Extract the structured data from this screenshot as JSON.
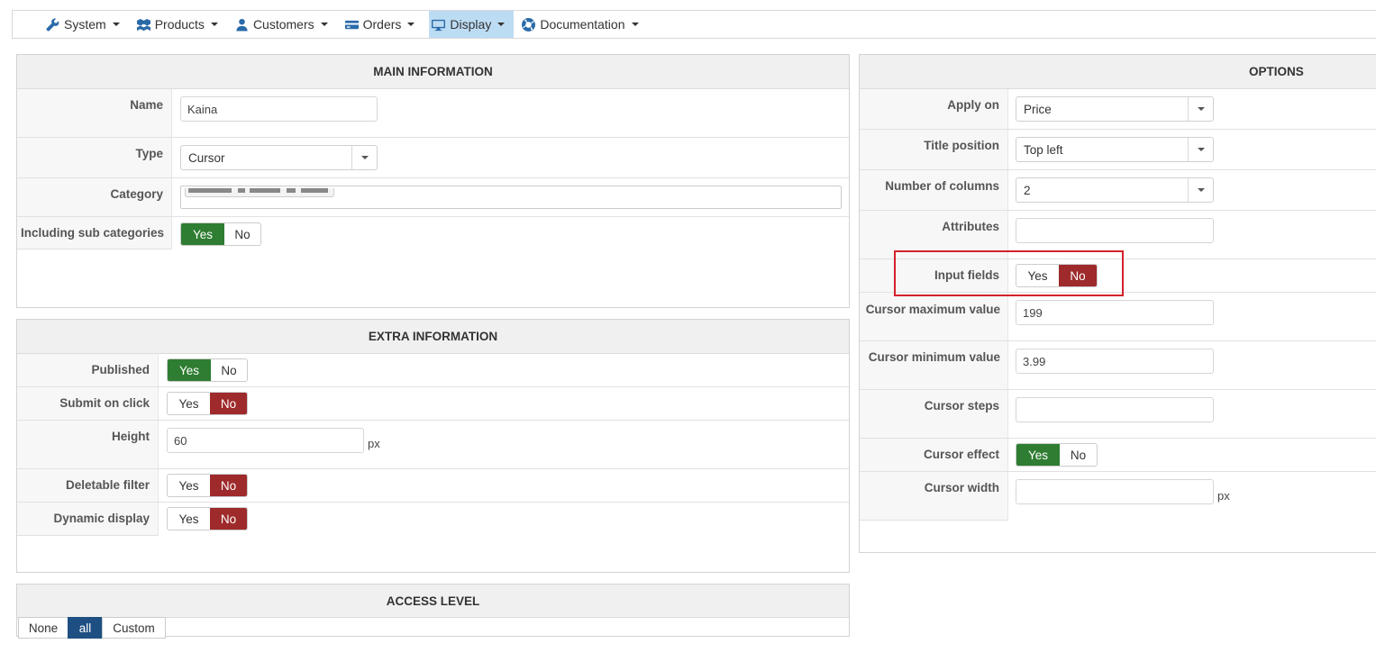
{
  "menu": [
    {
      "label": "System",
      "icon": "wrench-icon"
    },
    {
      "label": "Products",
      "icon": "cubes-icon"
    },
    {
      "label": "Customers",
      "icon": "user-icon"
    },
    {
      "label": "Orders",
      "icon": "credit-card-icon"
    },
    {
      "label": "Display",
      "icon": "monitor-icon",
      "active": true
    },
    {
      "label": "Documentation",
      "icon": "lifebuoy-icon"
    }
  ],
  "main_info": {
    "title": "MAIN INFORMATION",
    "name_label": "Name",
    "name_value": "Kaina",
    "type_label": "Type",
    "type_value": "Cursor",
    "category_label": "Category",
    "sub_label": "Including sub categories",
    "sub_value": "Yes"
  },
  "extra_info": {
    "title": "EXTRA INFORMATION",
    "published_label": "Published",
    "published_value": "Yes",
    "submit_label": "Submit on click",
    "submit_value": "No",
    "height_label": "Height",
    "height_value": "60",
    "height_unit": "px",
    "deletable_label": "Deletable filter",
    "deletable_value": "No",
    "dynamic_label": "Dynamic display",
    "dynamic_value": "No"
  },
  "access": {
    "title": "ACCESS LEVEL",
    "none": "None",
    "all": "all",
    "custom": "Custom",
    "selected": "all"
  },
  "options": {
    "title": "OPTIONS",
    "apply_label": "Apply on",
    "apply_value": "Price",
    "title_pos_label": "Title position",
    "title_pos_value": "Top left",
    "cols_label": "Number of columns",
    "cols_value": "2",
    "attr_label": "Attributes",
    "attr_value": "",
    "input_label": "Input fields",
    "input_value": "No",
    "max_label": "Cursor maximum value",
    "max_value": "199",
    "min_label": "Cursor minimum value",
    "min_value": "3.99",
    "steps_label": "Cursor steps",
    "steps_value": "",
    "effect_label": "Cursor effect",
    "effect_value": "Yes",
    "width_label": "Cursor width",
    "width_value": "",
    "width_unit": "px"
  },
  "toggle": {
    "yes": "Yes",
    "no": "No"
  },
  "colors": {
    "yes_active": "#2e7d32",
    "no_active": "#9e2a2b",
    "access_active": "#1e4f82",
    "highlight": "#d3222a",
    "menu_active": "#bcdcf3"
  }
}
